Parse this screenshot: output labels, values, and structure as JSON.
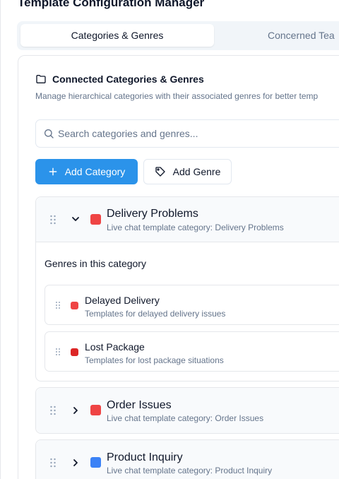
{
  "page": {
    "title": "Template Configuration Manager"
  },
  "tabs": [
    {
      "label": "Categories & Genres",
      "active": true
    },
    {
      "label": "Concerned Tea",
      "active": false
    }
  ],
  "section": {
    "title": "Connected Categories & Genres",
    "description": "Manage hierarchical categories with their associated genres for better temp"
  },
  "search": {
    "placeholder": "Search categories and genres..."
  },
  "toolbar": {
    "add_category_label": "Add Category",
    "add_genre_label": "Add Genre"
  },
  "colors": {
    "primary": "#2b93ea",
    "red": "#ef4444",
    "dark_red": "#dc2626",
    "blue": "#3b82f6"
  },
  "categories": [
    {
      "name": "Delivery Problems",
      "description": "Live chat template category: Delivery Problems",
      "color": "#ef4444",
      "expanded": true,
      "genres_title": "Genres in this category",
      "genres": [
        {
          "name": "Delayed Delivery",
          "description": "Templates for delayed delivery issues",
          "color": "#ef4444"
        },
        {
          "name": "Lost Package",
          "description": "Templates for lost package situations",
          "color": "#dc2626"
        }
      ]
    },
    {
      "name": "Order Issues",
      "description": "Live chat template category: Order Issues",
      "color": "#ef4444",
      "expanded": false
    },
    {
      "name": "Product Inquiry",
      "description": "Live chat template category: Product Inquiry",
      "color": "#3b82f6",
      "expanded": false
    }
  ]
}
